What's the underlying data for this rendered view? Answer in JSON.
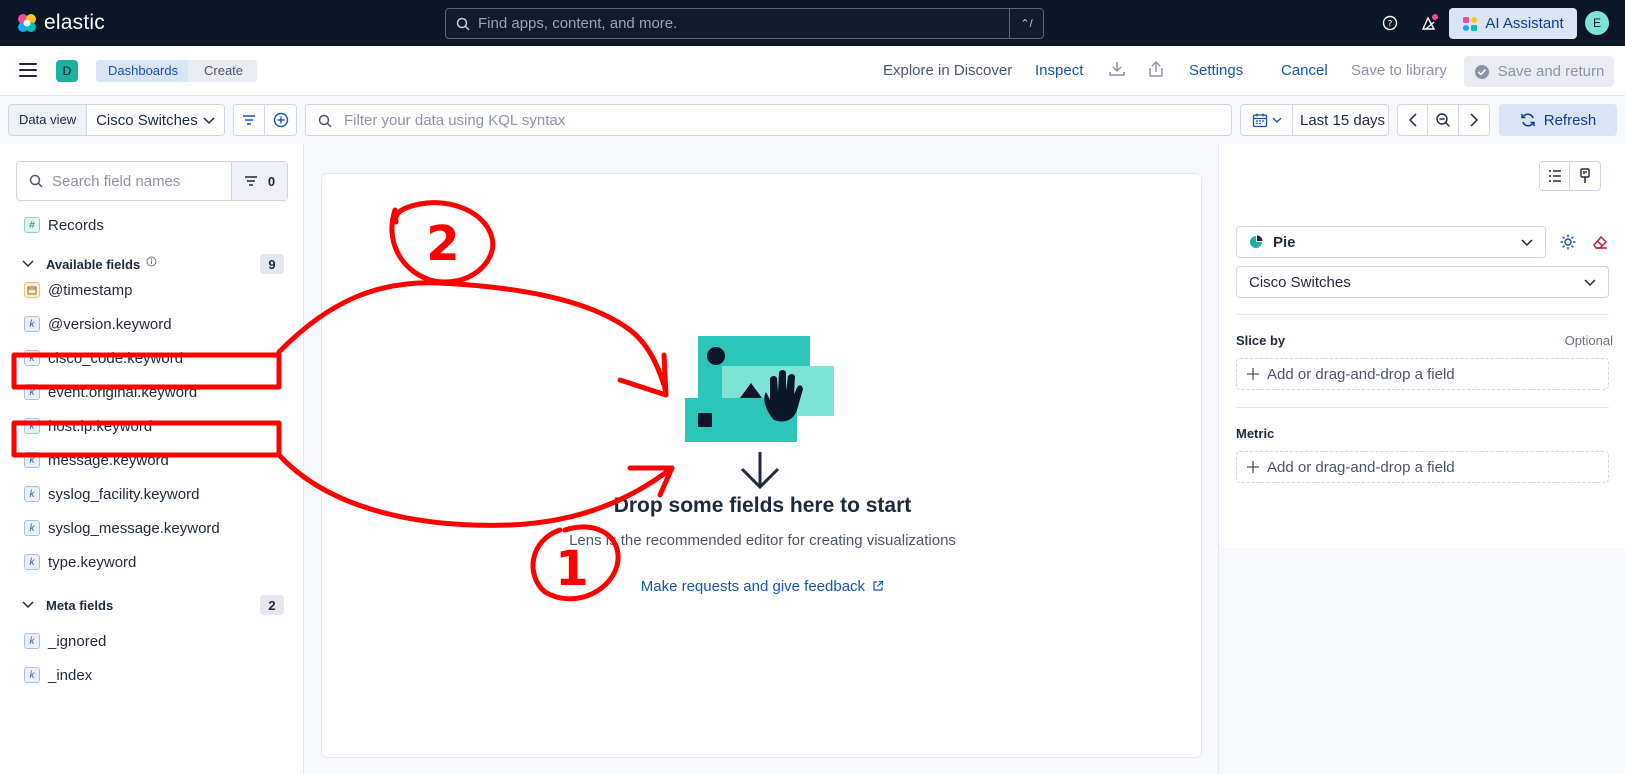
{
  "topbar": {
    "brand": "elastic",
    "search_placeholder": "Find apps, content, and more.",
    "search_shortcut": "⌃/",
    "ai_assistant_label": "AI Assistant",
    "avatar_initial": "E"
  },
  "header": {
    "space_initial": "D",
    "breadcrumbs": [
      "Dashboards",
      "Create"
    ],
    "explore_label": "Explore in Discover",
    "inspect_label": "Inspect",
    "settings_label": "Settings",
    "cancel_label": "Cancel",
    "save_library_label": "Save to library",
    "save_return_label": "Save and return"
  },
  "querybar": {
    "data_view_label": "Data view",
    "data_view_value": "Cisco Switches",
    "kql_placeholder": "Filter your data using KQL syntax",
    "time_range": "Last 15 days",
    "refresh_label": "Refresh"
  },
  "fields": {
    "search_placeholder": "Search field names",
    "filter_count": "0",
    "records_label": "Records",
    "available_header": "Available fields",
    "available_count": "9",
    "available": [
      {
        "name": "@timestamp",
        "type": "date"
      },
      {
        "name": "@version.keyword",
        "type": "keyword"
      },
      {
        "name": "cisco_code.keyword",
        "type": "keyword"
      },
      {
        "name": "event.original.keyword",
        "type": "keyword"
      },
      {
        "name": "host.ip.keyword",
        "type": "keyword"
      },
      {
        "name": "message.keyword",
        "type": "keyword"
      },
      {
        "name": "syslog_facility.keyword",
        "type": "keyword"
      },
      {
        "name": "syslog_message.keyword",
        "type": "keyword"
      },
      {
        "name": "type.keyword",
        "type": "keyword"
      }
    ],
    "meta_header": "Meta fields",
    "meta_count": "2",
    "meta": [
      {
        "name": "_ignored",
        "type": "keyword"
      },
      {
        "name": "_index",
        "type": "keyword"
      }
    ],
    "token_k": "k",
    "token_n": "#"
  },
  "workspace": {
    "drop_title": "Drop some fields here to start",
    "drop_subtitle": "Lens is the recommended editor for creating visualizations",
    "feedback_link": "Make requests and give feedback"
  },
  "config": {
    "chart_type": "Pie",
    "layer_data_view": "Cisco Switches",
    "slice_label": "Slice by",
    "slice_optional": "Optional",
    "slice_placeholder": "Add or drag-and-drop a field",
    "metric_label": "Metric",
    "metric_placeholder": "Add or drag-and-drop a field"
  },
  "annotations": {
    "color": "#ff0000",
    "labels": [
      "2",
      "1"
    ]
  },
  "colors": {
    "topbar_bg": "#0b1628",
    "accent_blue": "#1355b6",
    "teal": "#20b09f"
  }
}
